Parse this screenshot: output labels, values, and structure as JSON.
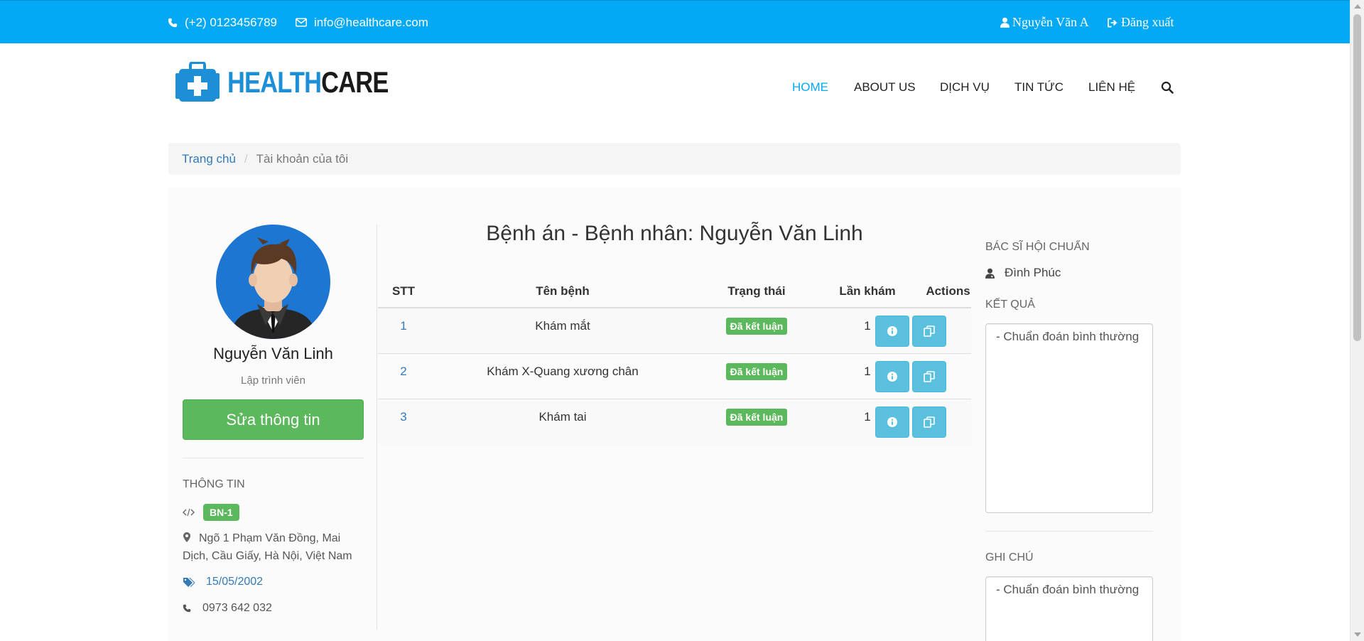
{
  "topbar": {
    "phone": "(+2) 0123456789",
    "email": "info@healthcare.com",
    "user": "Nguyễn Văn A",
    "logout": "Đăng xuất"
  },
  "logo": {
    "part1": "HEALTH",
    "part2": "CARE"
  },
  "nav": {
    "home": "HOME",
    "about": "ABOUT US",
    "services": "DỊCH VỤ",
    "news": "TIN TỨC",
    "contact": "LIÊN HỆ"
  },
  "breadcrumb": {
    "home": "Trang chủ",
    "separator": "/",
    "current": "Tài khoản của tôi"
  },
  "profile": {
    "name": "Nguyễn Văn Linh",
    "role": "Lập trình viên",
    "edit_label": "Sửa thông tin",
    "info_title": "THÔNG TIN",
    "code": "BN-1",
    "address": "Ngõ 1 Phạm Văn Đồng, Mai Dịch, Cầu Giấy, Hà Nội, Việt Nam",
    "birthday": "15/05/2002",
    "phone": "0973 642 032"
  },
  "record": {
    "title": "Bệnh án - Bệnh nhân: Nguyễn Văn Linh",
    "columns": {
      "stt": "STT",
      "name": "Tên bệnh",
      "status": "Trạng thái",
      "times": "Lần khám",
      "actions": "Actions"
    },
    "rows": [
      {
        "stt": "1",
        "name": "Khám mắt",
        "status": "Đã kết luận",
        "times": "1"
      },
      {
        "stt": "2",
        "name": "Khám X-Quang xương chân",
        "status": "Đã kết luận",
        "times": "1"
      },
      {
        "stt": "3",
        "name": "Khám tai",
        "status": "Đã kết luận",
        "times": "1"
      }
    ]
  },
  "right": {
    "doctor_label": "BÁC SĨ HỘI CHUẨN",
    "doctor_name": "Đình Phúc",
    "result_label": "KẾT QUẢ",
    "result_text": "- Chuẩn đoán bình thường",
    "note_label": "GHI CHÚ",
    "note_text": "- Chuẩn đoán bình thường"
  },
  "colors": {
    "topbar": "#03a9f4",
    "success": "#5cb85c",
    "info": "#5bc0de",
    "link": "#337ab7"
  }
}
